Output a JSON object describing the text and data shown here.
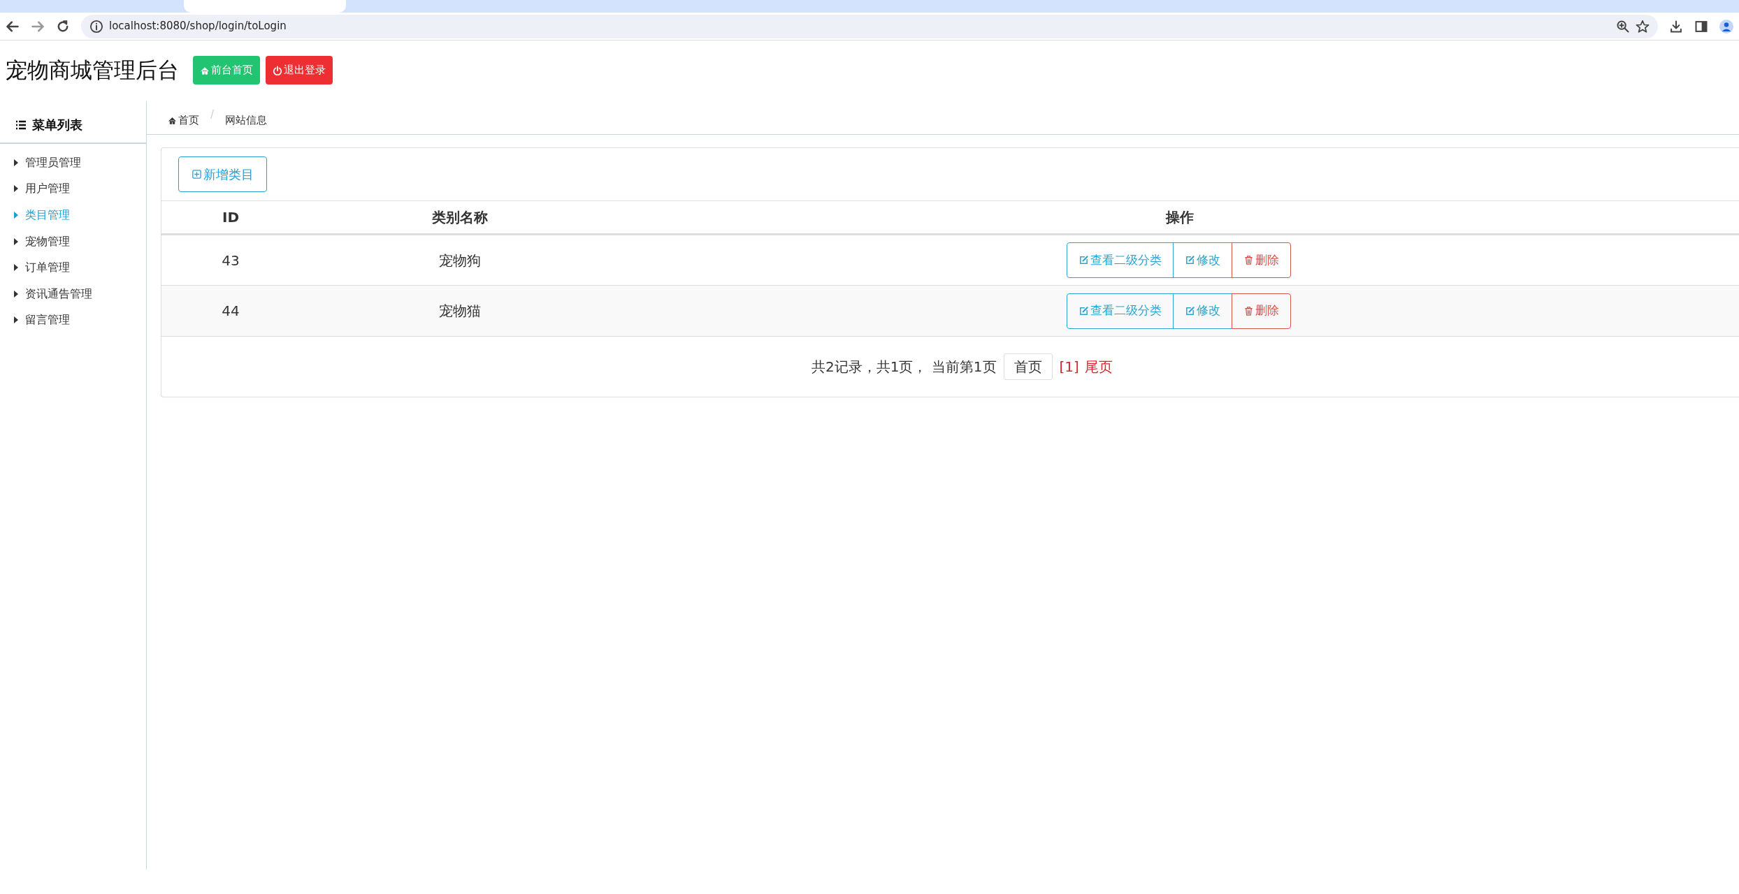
{
  "browser": {
    "url": "localhost:8080/shop/login/toLogin"
  },
  "header": {
    "title": "宠物商城管理后台",
    "buttons": [
      {
        "label": "前台首页",
        "kind": "home"
      },
      {
        "label": "退出登录",
        "kind": "logout"
      }
    ]
  },
  "sidebar": {
    "title": "菜单列表",
    "items": [
      {
        "label": "管理员管理",
        "selected": false
      },
      {
        "label": "用户管理",
        "selected": false
      },
      {
        "label": "类目管理",
        "selected": true
      },
      {
        "label": "宠物管理",
        "selected": false
      },
      {
        "label": "订单管理",
        "selected": false
      },
      {
        "label": "资讯通告管理",
        "selected": false
      },
      {
        "label": "留言管理",
        "selected": false
      }
    ]
  },
  "breadcrumb": [
    {
      "label": "首页",
      "kind": "home"
    },
    {
      "label": "网站信息",
      "kind": "page",
      "separator": "/"
    }
  ],
  "toolbar": {
    "add_button": "新增类目"
  },
  "table": {
    "columns": [
      "ID",
      "类别名称",
      "操作"
    ],
    "rows": [
      {
        "cells": [
          "43",
          "宠物狗"
        ],
        "actions": [
          {
            "label": "查看二级分类",
            "kind": "edit"
          },
          {
            "label": "修改",
            "kind": "edit"
          },
          {
            "label": "删除",
            "kind": "delete"
          }
        ]
      },
      {
        "cells": [
          "44",
          "宠物猫"
        ],
        "actions": [
          {
            "label": "查看二级分类",
            "kind": "edit"
          },
          {
            "label": "修改",
            "kind": "edit"
          },
          {
            "label": "删除",
            "kind": "delete"
          }
        ]
      }
    ]
  },
  "pagination": {
    "summary": "共2记录，共1页， 当前第1页",
    "first": "首页",
    "current": "[1]",
    "last": "尾页"
  }
}
